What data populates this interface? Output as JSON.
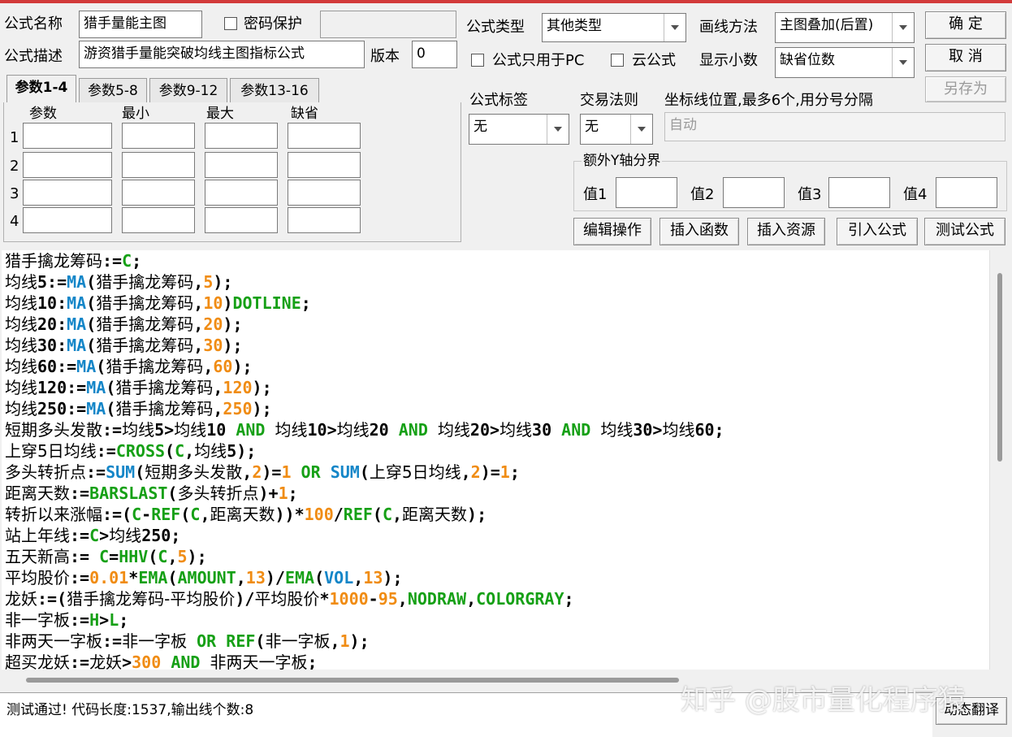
{
  "form": {
    "name_label": "公式名称",
    "name_value": "猎手量能主图",
    "password_label": "密码保护",
    "password_value": "",
    "desc_label": "公式描述",
    "desc_value": "游资猎手量能突破均线主图指标公式",
    "version_label": "版本",
    "version_value": "0",
    "type_label": "公式类型",
    "type_value": "其他类型",
    "draw_label": "画线方法",
    "draw_value": "主图叠加(后置)",
    "pc_only_label": "公式只用于PC",
    "cloud_label": "云公式",
    "decimal_label": "显示小数",
    "decimal_value": "缺省位数"
  },
  "buttons": {
    "ok": "确  定",
    "cancel": "取  消",
    "save_as": "另存为",
    "edit_ops": "编辑操作",
    "insert_func": "插入函数",
    "insert_res": "插入资源",
    "import_formula": "引入公式",
    "test_formula": "测试公式",
    "dynamic_translate": "动态翻译"
  },
  "tabs": [
    "参数1-4",
    "参数5-8",
    "参数9-12",
    "参数13-16"
  ],
  "params": {
    "headers": [
      "参数",
      "最小",
      "最大",
      "缺省"
    ],
    "rows": [
      "1",
      "2",
      "3",
      "4"
    ]
  },
  "right": {
    "tag_label": "公式标签",
    "tag_value": "无",
    "rule_label": "交易法则",
    "rule_value": "无",
    "coord_label": "坐标线位置,最多6个,用分号分隔",
    "coord_value": "自动",
    "yaxis_group": "额外Y轴分界",
    "val1": "值1",
    "val2": "值2",
    "val3": "值3",
    "val4": "值4"
  },
  "code_lines": [
    [
      [
        "k",
        "猎手擒龙筹码"
      ],
      [
        "p",
        ":="
      ],
      [
        "g",
        "C"
      ],
      [
        "p",
        ";"
      ]
    ],
    [
      [
        "k",
        "均线"
      ],
      [
        "p",
        "5:="
      ],
      [
        "f",
        "MA"
      ],
      [
        "p",
        "("
      ],
      [
        "k",
        "猎手擒龙筹码"
      ],
      [
        "p",
        ","
      ],
      [
        "n",
        "5"
      ],
      [
        "p",
        ");"
      ]
    ],
    [
      [
        "k",
        "均线"
      ],
      [
        "p",
        "10:"
      ],
      [
        "f",
        "MA"
      ],
      [
        "p",
        "("
      ],
      [
        "k",
        "猎手擒龙筹码"
      ],
      [
        "p",
        ","
      ],
      [
        "n",
        "10"
      ],
      [
        "p",
        ")"
      ],
      [
        "g",
        "DOTLINE"
      ],
      [
        "p",
        ";"
      ]
    ],
    [
      [
        "k",
        "均线"
      ],
      [
        "p",
        "20:"
      ],
      [
        "f",
        "MA"
      ],
      [
        "p",
        "("
      ],
      [
        "k",
        "猎手擒龙筹码"
      ],
      [
        "p",
        ","
      ],
      [
        "n",
        "20"
      ],
      [
        "p",
        ");"
      ]
    ],
    [
      [
        "k",
        "均线"
      ],
      [
        "p",
        "30:"
      ],
      [
        "f",
        "MA"
      ],
      [
        "p",
        "("
      ],
      [
        "k",
        "猎手擒龙筹码"
      ],
      [
        "p",
        ","
      ],
      [
        "n",
        "30"
      ],
      [
        "p",
        ");"
      ]
    ],
    [
      [
        "k",
        "均线"
      ],
      [
        "p",
        "60:="
      ],
      [
        "f",
        "MA"
      ],
      [
        "p",
        "("
      ],
      [
        "k",
        "猎手擒龙筹码"
      ],
      [
        "p",
        ","
      ],
      [
        "n",
        "60"
      ],
      [
        "p",
        ");"
      ]
    ],
    [
      [
        "k",
        "均线"
      ],
      [
        "p",
        "120:="
      ],
      [
        "f",
        "MA"
      ],
      [
        "p",
        "("
      ],
      [
        "k",
        "猎手擒龙筹码"
      ],
      [
        "p",
        ","
      ],
      [
        "n",
        "120"
      ],
      [
        "p",
        ");"
      ]
    ],
    [
      [
        "k",
        "均线"
      ],
      [
        "p",
        "250:="
      ],
      [
        "f",
        "MA"
      ],
      [
        "p",
        "("
      ],
      [
        "k",
        "猎手擒龙筹码"
      ],
      [
        "p",
        ","
      ],
      [
        "n",
        "250"
      ],
      [
        "p",
        ");"
      ]
    ],
    [
      [
        "k",
        "短期多头发散"
      ],
      [
        "p",
        ":="
      ],
      [
        "k",
        "均线"
      ],
      [
        "p",
        "5>"
      ],
      [
        "k",
        "均线"
      ],
      [
        "p",
        "10 "
      ],
      [
        "g",
        "AND"
      ],
      [
        "p",
        " "
      ],
      [
        "k",
        "均线"
      ],
      [
        "p",
        "10>"
      ],
      [
        "k",
        "均线"
      ],
      [
        "p",
        "20 "
      ],
      [
        "g",
        "AND"
      ],
      [
        "p",
        " "
      ],
      [
        "k",
        "均线"
      ],
      [
        "p",
        "20>"
      ],
      [
        "k",
        "均线"
      ],
      [
        "p",
        "30 "
      ],
      [
        "g",
        "AND"
      ],
      [
        "p",
        " "
      ],
      [
        "k",
        "均线"
      ],
      [
        "p",
        "30>"
      ],
      [
        "k",
        "均线"
      ],
      [
        "p",
        "60;"
      ]
    ],
    [
      [
        "k",
        "上穿5日均线"
      ],
      [
        "p",
        ":="
      ],
      [
        "g",
        "CROSS"
      ],
      [
        "p",
        "("
      ],
      [
        "g",
        "C"
      ],
      [
        "p",
        ","
      ],
      [
        "k",
        "均线"
      ],
      [
        "p",
        "5);"
      ]
    ],
    [
      [
        "k",
        "多头转折点"
      ],
      [
        "p",
        ":="
      ],
      [
        "f",
        "SUM"
      ],
      [
        "p",
        "("
      ],
      [
        "k",
        "短期多头发散"
      ],
      [
        "p",
        ","
      ],
      [
        "n",
        "2"
      ],
      [
        "p",
        ")="
      ],
      [
        "n",
        "1"
      ],
      [
        "p",
        " "
      ],
      [
        "g",
        "OR"
      ],
      [
        "p",
        " "
      ],
      [
        "f",
        "SUM"
      ],
      [
        "p",
        "("
      ],
      [
        "k",
        "上穿5日均线"
      ],
      [
        "p",
        ","
      ],
      [
        "n",
        "2"
      ],
      [
        "p",
        ")="
      ],
      [
        "n",
        "1"
      ],
      [
        "p",
        ";"
      ]
    ],
    [
      [
        "k",
        "距离天数"
      ],
      [
        "p",
        ":="
      ],
      [
        "g",
        "BARSLAST"
      ],
      [
        "p",
        "("
      ],
      [
        "k",
        "多头转折点"
      ],
      [
        "p",
        ")+"
      ],
      [
        "n",
        "1"
      ],
      [
        "p",
        ";"
      ]
    ],
    [
      [
        "k",
        "转折以来涨幅"
      ],
      [
        "p",
        ":=("
      ],
      [
        "g",
        "C"
      ],
      [
        "p",
        "-"
      ],
      [
        "g",
        "REF"
      ],
      [
        "p",
        "("
      ],
      [
        "g",
        "C"
      ],
      [
        "p",
        ","
      ],
      [
        "k",
        "距离天数"
      ],
      [
        "p",
        "))*"
      ],
      [
        "n",
        "100"
      ],
      [
        "p",
        "/"
      ],
      [
        "g",
        "REF"
      ],
      [
        "p",
        "("
      ],
      [
        "g",
        "C"
      ],
      [
        "p",
        ","
      ],
      [
        "k",
        "距离天数"
      ],
      [
        "p",
        ");"
      ]
    ],
    [
      [
        "k",
        "站上年线"
      ],
      [
        "p",
        ":="
      ],
      [
        "g",
        "C"
      ],
      [
        "p",
        ">"
      ],
      [
        "k",
        "均线"
      ],
      [
        "p",
        "250;"
      ]
    ],
    [
      [
        "k",
        "五天新高"
      ],
      [
        "p",
        ":= "
      ],
      [
        "g",
        "C"
      ],
      [
        "p",
        "="
      ],
      [
        "g",
        "HHV"
      ],
      [
        "p",
        "("
      ],
      [
        "g",
        "C"
      ],
      [
        "p",
        ","
      ],
      [
        "n",
        "5"
      ],
      [
        "p",
        ");"
      ]
    ],
    [
      [
        "k",
        "平均股价"
      ],
      [
        "p",
        ":="
      ],
      [
        "n",
        "0.01"
      ],
      [
        "p",
        "*"
      ],
      [
        "g",
        "EMA"
      ],
      [
        "p",
        "("
      ],
      [
        "g",
        "AMOUNT"
      ],
      [
        "p",
        ","
      ],
      [
        "n",
        "13"
      ],
      [
        "p",
        ")/"
      ],
      [
        "g",
        "EMA"
      ],
      [
        "p",
        "("
      ],
      [
        "f",
        "VOL"
      ],
      [
        "p",
        ","
      ],
      [
        "n",
        "13"
      ],
      [
        "p",
        ");"
      ]
    ],
    [
      [
        "k",
        "龙妖"
      ],
      [
        "p",
        ":=("
      ],
      [
        "k",
        "猎手擒龙筹码-平均股价"
      ],
      [
        "p",
        ")/"
      ],
      [
        "k",
        "平均股价"
      ],
      [
        "p",
        "*"
      ],
      [
        "n",
        "1000"
      ],
      [
        "p",
        "-"
      ],
      [
        "n",
        "95"
      ],
      [
        "p",
        ","
      ],
      [
        "g",
        "NODRAW"
      ],
      [
        "p",
        ","
      ],
      [
        "g",
        "COLORGRAY"
      ],
      [
        "p",
        ";"
      ]
    ],
    [
      [
        "k",
        "非一字板"
      ],
      [
        "p",
        ":="
      ],
      [
        "g",
        "H"
      ],
      [
        "p",
        ">"
      ],
      [
        "g",
        "L"
      ],
      [
        "p",
        ";"
      ]
    ],
    [
      [
        "k",
        "非两天一字板"
      ],
      [
        "p",
        ":="
      ],
      [
        "k",
        "非一字板"
      ],
      [
        "p",
        " "
      ],
      [
        "g",
        "OR"
      ],
      [
        "p",
        " "
      ],
      [
        "g",
        "REF"
      ],
      [
        "p",
        "("
      ],
      [
        "k",
        "非一字板"
      ],
      [
        "p",
        ","
      ],
      [
        "n",
        "1"
      ],
      [
        "p",
        ");"
      ]
    ],
    [
      [
        "k",
        "超买龙妖"
      ],
      [
        "p",
        ":="
      ],
      [
        "k",
        "龙妖"
      ],
      [
        "p",
        ">"
      ],
      [
        "n",
        "300"
      ],
      [
        "p",
        " "
      ],
      [
        "g",
        "AND"
      ],
      [
        "p",
        " "
      ],
      [
        "k",
        "非两天一字板"
      ],
      [
        "p",
        ";"
      ]
    ]
  ],
  "status": "测试通过! 代码长度:1537,输出线个数:8",
  "watermark": "知乎 @股市量化程序猿",
  "colors": {
    "keyword_green": "#16a016",
    "function_blue": "#1486c8",
    "number_orange": "#f08c14",
    "title_bar_red": "#d23a3a"
  }
}
